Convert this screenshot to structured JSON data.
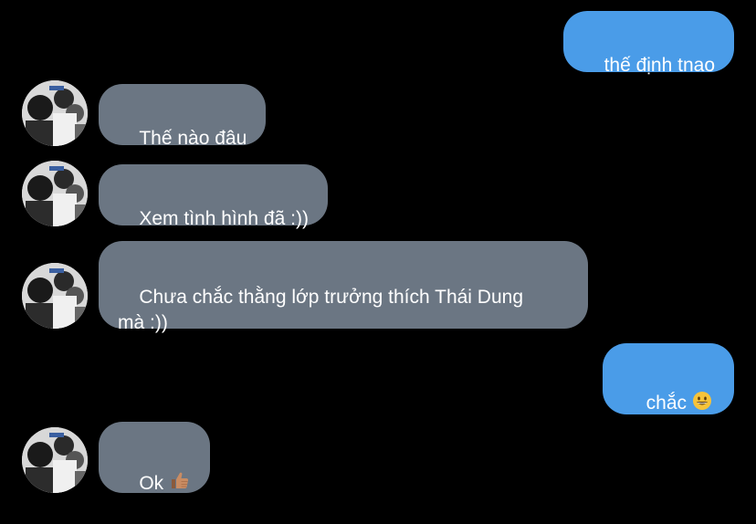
{
  "conversation": {
    "messages": [
      {
        "direction": "outgoing",
        "text": "thế định tnao"
      },
      {
        "direction": "incoming",
        "text": "Thế nào đâu"
      },
      {
        "direction": "incoming",
        "text": "Xem tình hình đã :))"
      },
      {
        "direction": "incoming",
        "text": "Chưa chắc thằng lớp trưởng thích Thái Dung\nmà :))"
      },
      {
        "direction": "outgoing",
        "text": "chắc",
        "emoji": "grinning-face"
      },
      {
        "direction": "incoming",
        "text": "Ok",
        "emoji": "thumbs-up-medium-skin"
      }
    ]
  },
  "colors": {
    "background": "#000000",
    "outgoing_bubble": "#4a9ce8",
    "incoming_bubble": "#6b7683",
    "text": "#ffffff"
  }
}
